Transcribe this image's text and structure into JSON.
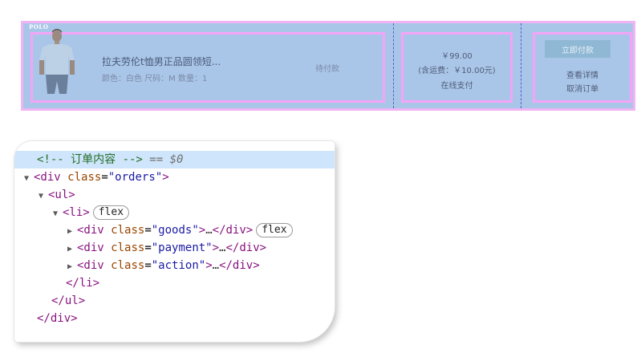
{
  "order": {
    "goods": {
      "logo_text": "POLO",
      "name": "拉夫劳伦t恤男正品圆领短...",
      "attrs": "颜色：白色 尺码：M 数量：1",
      "status": "待付款"
    },
    "payment": {
      "price": "￥99.00",
      "shipping": "(含运费：￥10.00元)",
      "method": "在线支付"
    },
    "action": {
      "pay_button": "立即付款",
      "details_link": "查看详情",
      "cancel_link": "取消订单"
    }
  },
  "devtools": {
    "comment": "<!-- 订单内容 -->",
    "ref": "== $0",
    "badge_flex": "flex",
    "lines": {
      "orders_class": "\"orders\"",
      "goods_class": "\"goods\"",
      "payment_class": "\"payment\"",
      "action_class": "\"action\""
    }
  },
  "colors": {
    "row_bg": "#a9c6e8",
    "highlight_border": "#f3a4f7",
    "selected_line": "#cfe5fb"
  }
}
